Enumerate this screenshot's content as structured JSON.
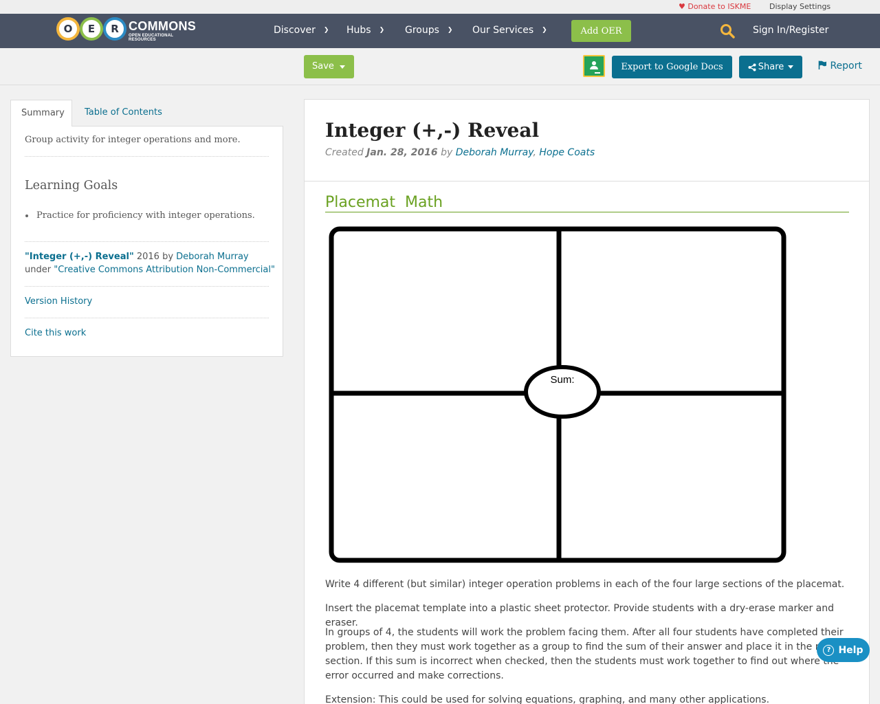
{
  "utility": {
    "donate": "Donate to ISKME",
    "display_settings": "Display Settings"
  },
  "logo": {
    "letters": [
      "O",
      "E",
      "R"
    ],
    "word": "COMMONS",
    "sub": "OPEN EDUCATIONAL RESOURCES",
    "ring_colors": [
      "#f4b63d",
      "#8cbf4a",
      "#2c8bc4"
    ]
  },
  "nav": {
    "items": [
      {
        "label": "Discover"
      },
      {
        "label": "Hubs"
      },
      {
        "label": "Groups"
      },
      {
        "label": "Our Services"
      }
    ],
    "add_oer": "Add OER",
    "sign_in": "Sign In/Register"
  },
  "toolbar": {
    "save": "Save",
    "export": "Export to Google Docs",
    "share": "Share",
    "report": "Report"
  },
  "tabs": {
    "summary": "Summary",
    "toc": "Table of Contents"
  },
  "sidebar": {
    "summary_text": "Group activity for integer operations and more.",
    "goals_heading": "Learning Goals",
    "goals": [
      "Practice for proficiency with integer operations."
    ],
    "attribution": {
      "work_title": "\"Integer (+,-) Reveal\"",
      "year_by": " 2016 by ",
      "author": "Deborah Murray",
      "under": "under ",
      "license": "\"Creative Commons Attribution Non-Commercial\""
    },
    "version_history": "Version History",
    "cite": "Cite this work"
  },
  "resource": {
    "title": "Integer (+,-) Reveal",
    "created_label": "Created ",
    "created_date": "Jan. 28, 2016",
    "by": " by ",
    "authors": [
      "Deborah Murray",
      "Hope Coats"
    ],
    "author_sep": ", ",
    "section_heading": "Placemat  Math",
    "placemat_label": "Sum:",
    "paragraphs": [
      "Write 4 different (but similar) integer operation problems in each of the four large sections of the placemat.",
      "Insert the placemat template into a plastic sheet protector.  Provide students with a dry-erase marker and eraser.",
      "In groups of 4, the students will work the problem facing them.  After all four students have completed their problem, then they must work together as a group to find the sum of their answer and place it in the middle section.  If this sum is incorrect when checked, then the students must work together to find out where the error occurred and make corrections.",
      "Extension:  This could be used for solving equations, graphing, and many other applications."
    ]
  },
  "help": {
    "label": "Help"
  },
  "colors": {
    "nav_bg": "#495264",
    "accent_green": "#8cbf4a",
    "accent_blue": "#0b6f8f",
    "heading_green": "#6aa121"
  }
}
